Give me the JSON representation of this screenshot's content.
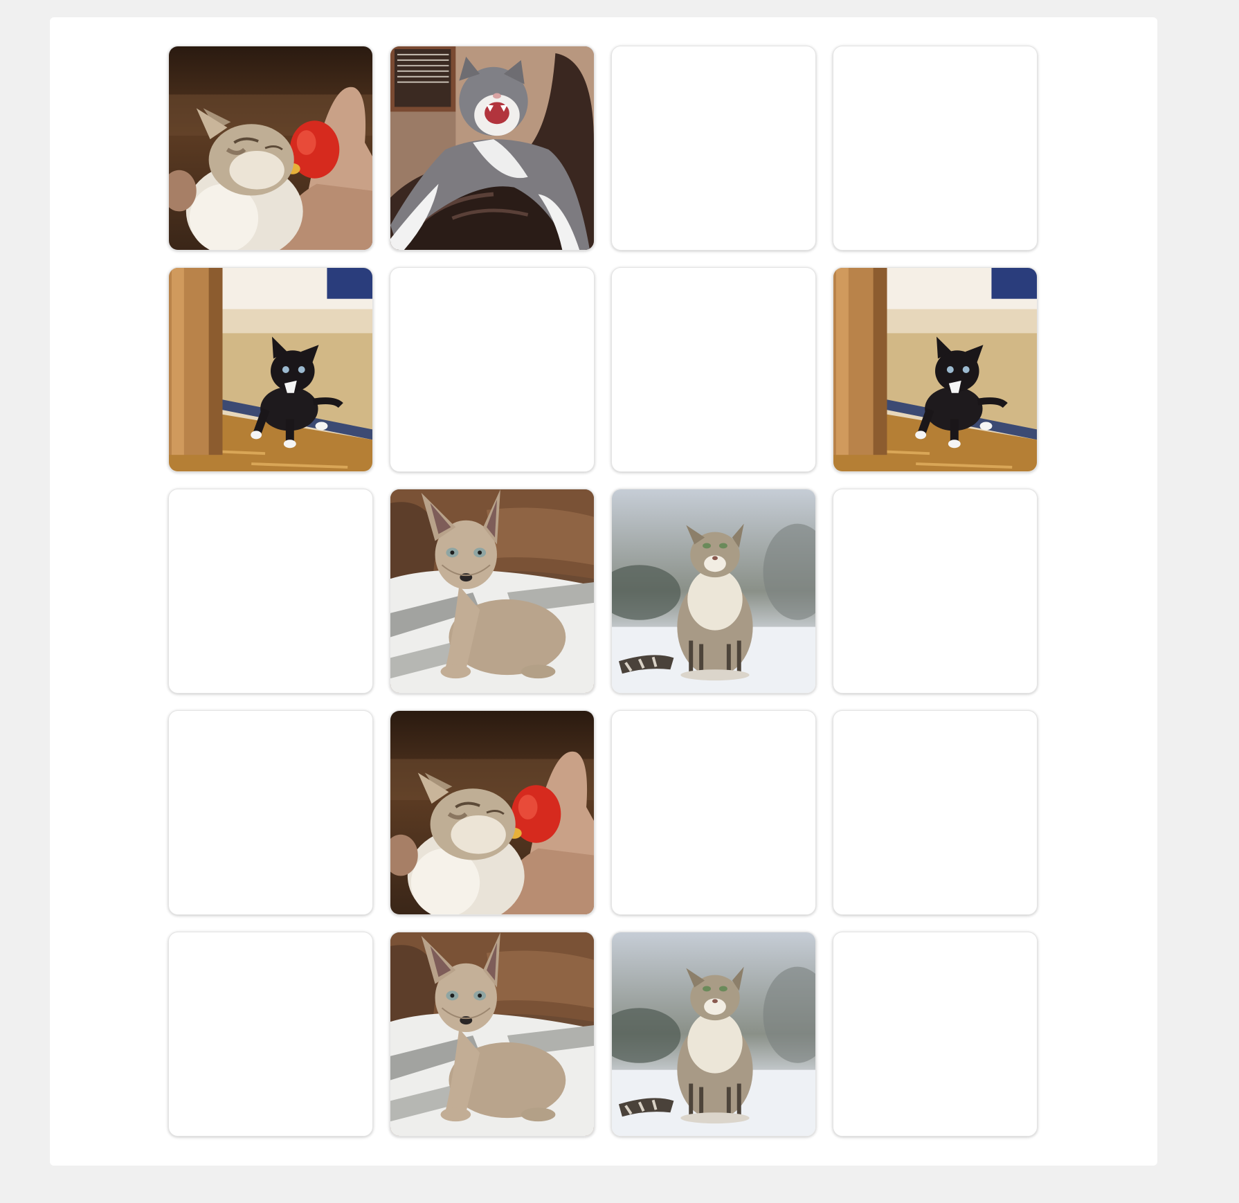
{
  "game": {
    "columns": 4,
    "rows": 5,
    "cards": [
      {
        "state": "face-up",
        "image": "kitten-bottle-feeding"
      },
      {
        "state": "face-up",
        "image": "gray-cat-yawning-on-chair"
      },
      {
        "state": "face-down",
        "image": null
      },
      {
        "state": "face-down",
        "image": null
      },
      {
        "state": "face-up",
        "image": "black-kitten-near-door"
      },
      {
        "state": "face-down",
        "image": null
      },
      {
        "state": "face-down",
        "image": null
      },
      {
        "state": "face-up",
        "image": "black-kitten-near-door"
      },
      {
        "state": "face-down",
        "image": null
      },
      {
        "state": "face-up",
        "image": "sphynx-kitten"
      },
      {
        "state": "face-up",
        "image": "fluffy-cat-in-snow"
      },
      {
        "state": "face-down",
        "image": null
      },
      {
        "state": "face-down",
        "image": null
      },
      {
        "state": "face-up",
        "image": "kitten-bottle-feeding"
      },
      {
        "state": "face-down",
        "image": null
      },
      {
        "state": "face-down",
        "image": null
      },
      {
        "state": "face-down",
        "image": null
      },
      {
        "state": "face-up",
        "image": "sphynx-kitten"
      },
      {
        "state": "face-up",
        "image": "fluffy-cat-in-snow"
      },
      {
        "state": "face-down",
        "image": null
      }
    ]
  },
  "colors": {
    "page_background": "#f0f0f0",
    "panel_background": "#ffffff",
    "card_back": "#ffffff"
  }
}
